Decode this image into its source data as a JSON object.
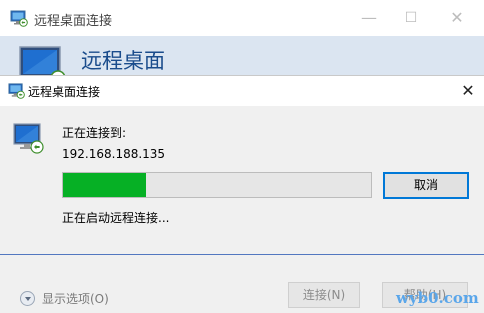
{
  "background_window": {
    "title": "远程桌面连接",
    "controls": {
      "minimize": "—",
      "maximize": "☐",
      "close": "✕"
    },
    "banner_title": "远程桌面",
    "show_options_label": "显示选项(O)",
    "connect_button": "连接(N)",
    "help_button": "帮助(H)"
  },
  "dialog": {
    "title": "远程桌面连接",
    "close": "✕",
    "connecting_label": "正在连接到:",
    "address": "192.168.188.135",
    "progress_fraction": 0.27,
    "progress_color": "#06b025",
    "cancel_button": "取消",
    "status": "正在启动远程连接..."
  },
  "watermark": "wyb0.com",
  "icons": [
    "remote-desktop-icon",
    "remote-desktop-monitor-icon",
    "chevron-down-icon",
    "close-icon",
    "minimize-icon",
    "maximize-icon"
  ]
}
